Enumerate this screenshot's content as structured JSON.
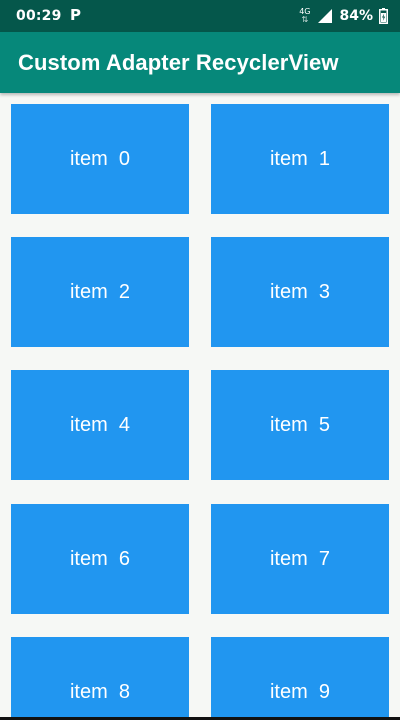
{
  "status_bar": {
    "time": "00:29",
    "app_indicator": "P",
    "network": "4G",
    "battery": "84%",
    "icons": [
      "signal-icon",
      "battery-icon"
    ]
  },
  "app_bar": {
    "title": "Custom Adapter RecyclerView",
    "color": "#06887a"
  },
  "list": {
    "tile_color": "#2196f0",
    "items": [
      {
        "label": "item  0"
      },
      {
        "label": "item  1"
      },
      {
        "label": "item  2"
      },
      {
        "label": "item  3"
      },
      {
        "label": "item  4"
      },
      {
        "label": "item  5"
      },
      {
        "label": "item  6"
      },
      {
        "label": "item  7"
      },
      {
        "label": "item  8"
      },
      {
        "label": "item  9"
      }
    ]
  }
}
